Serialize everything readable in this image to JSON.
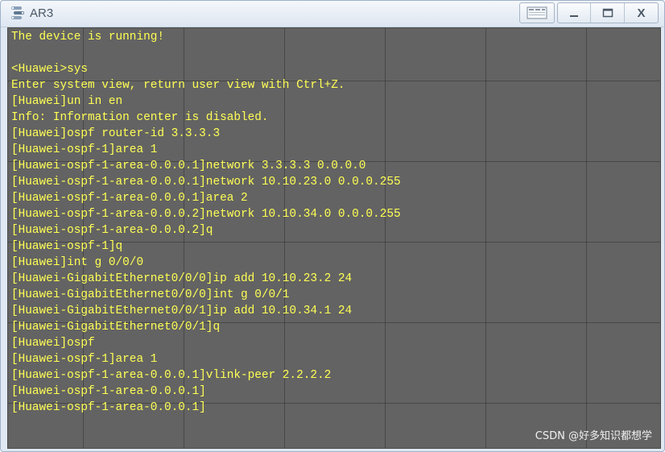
{
  "window": {
    "title": "AR3",
    "buttons": {
      "settings_icon": "settings-panel-icon",
      "minimize_icon": "minimize-icon",
      "maximize_icon": "maximize-icon",
      "close_label": "X"
    }
  },
  "terminal": {
    "text_color": "#ffff55",
    "background_color": "#636363",
    "lines": [
      "The device is running!",
      "",
      "<Huawei>sys",
      "Enter system view, return user view with Ctrl+Z.",
      "[Huawei]un in en",
      "Info: Information center is disabled.",
      "[Huawei]ospf router-id 3.3.3.3",
      "[Huawei-ospf-1]area 1",
      "[Huawei-ospf-1-area-0.0.0.1]network 3.3.3.3 0.0.0.0",
      "[Huawei-ospf-1-area-0.0.0.1]network 10.10.23.0 0.0.0.255",
      "[Huawei-ospf-1-area-0.0.0.1]area 2",
      "[Huawei-ospf-1-area-0.0.0.2]network 10.10.34.0 0.0.0.255",
      "[Huawei-ospf-1-area-0.0.0.2]q",
      "[Huawei-ospf-1]q",
      "[Huawei]int g 0/0/0",
      "[Huawei-GigabitEthernet0/0/0]ip add 10.10.23.2 24",
      "[Huawei-GigabitEthernet0/0/0]int g 0/0/1",
      "[Huawei-GigabitEthernet0/0/1]ip add 10.10.34.1 24",
      "[Huawei-GigabitEthernet0/0/1]q",
      "[Huawei]ospf",
      "[Huawei-ospf-1]area 1",
      "[Huawei-ospf-1-area-0.0.0.1]vlink-peer 2.2.2.2",
      "[Huawei-ospf-1-area-0.0.0.1]",
      "[Huawei-ospf-1-area-0.0.0.1]"
    ]
  },
  "watermark": "CSDN @好多知识都想学"
}
